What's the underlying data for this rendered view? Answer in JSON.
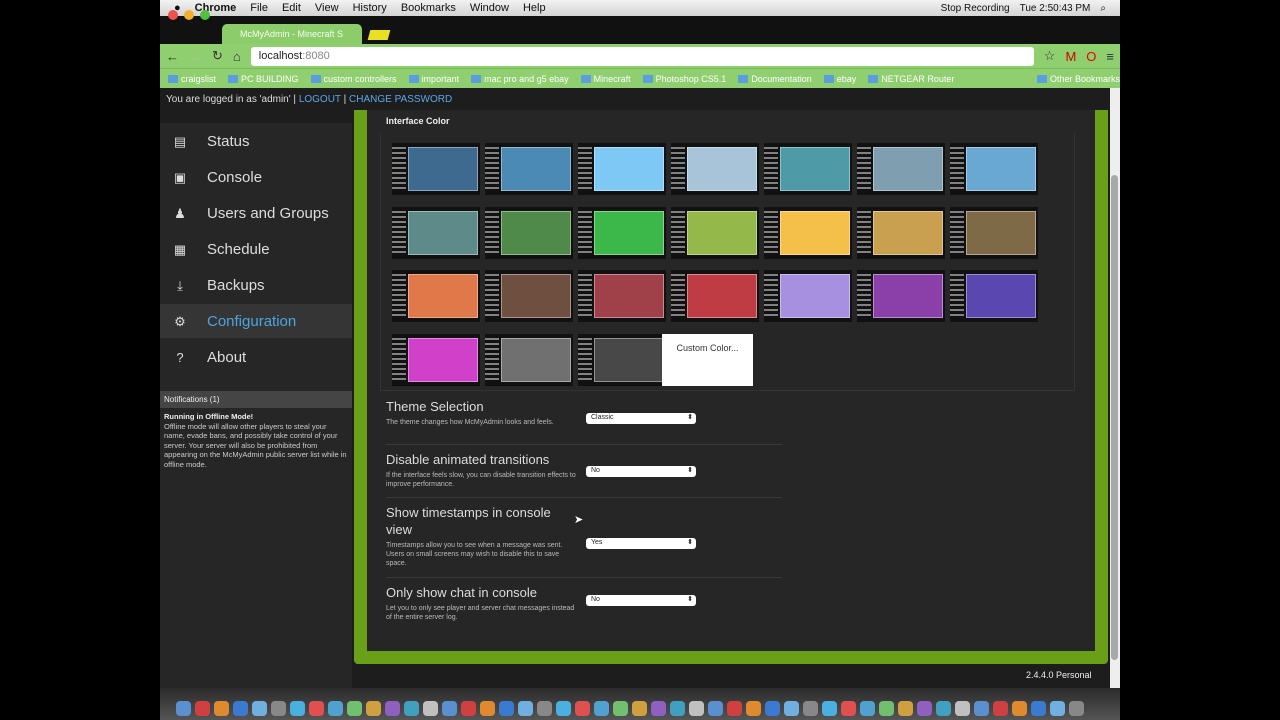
{
  "menubar": {
    "app": "Chrome",
    "items": [
      "File",
      "Edit",
      "View",
      "History",
      "Bookmarks",
      "Window",
      "Help"
    ],
    "status": [
      "Stop Recording",
      "Tue 2:50:43 PM"
    ]
  },
  "browser": {
    "tab_title": "McMyAdmin - Minecraft S",
    "url_host": "localhost",
    "url_port": ":8080",
    "bookmarks": [
      "craigslist",
      "PC BUILDING",
      "custom controllers",
      "important",
      "mac pro and g5 ebay",
      "Minecraft",
      "Photoshop CS5.1",
      "Documentation",
      "ebay",
      "NETGEAR Router",
      "Other Bookmarks"
    ]
  },
  "login": {
    "text": "You are logged in as 'admin' |",
    "logout": "LOGOUT",
    "sep": "|",
    "change_password": "CHANGE PASSWORD"
  },
  "sidebar": {
    "active": "Configuration",
    "items": [
      {
        "label": "Status",
        "icon": "status-icon",
        "glyph": "▤"
      },
      {
        "label": "Console",
        "icon": "console-icon",
        "glyph": "▣"
      },
      {
        "label": "Users and Groups",
        "icon": "users-icon",
        "glyph": "♟"
      },
      {
        "label": "Schedule",
        "icon": "calendar-icon",
        "glyph": "▦"
      },
      {
        "label": "Backups",
        "icon": "download-icon",
        "glyph": "⤓"
      },
      {
        "label": "Configuration",
        "icon": "gear-icon",
        "glyph": "⚙"
      },
      {
        "label": "About",
        "icon": "help-icon",
        "glyph": "?"
      }
    ]
  },
  "notifications": {
    "header": "Notifications (1)",
    "title": "Running in Offline Mode!",
    "body": "Offline mode will allow other players to steal your name, evade bans, and possibly take control of your server. Your server will also be prohibited from appearing on the McMyAdmin public server list while in offline mode."
  },
  "interface_color": {
    "title": "Interface Color",
    "custom_label": "Custom Color...",
    "colors": [
      [
        "#3f6a8f",
        "#4a8ab5",
        "#7ec8f5",
        "#a8c4d8",
        "#4e9aa6",
        "#7f9fb0",
        "#6aa8d4"
      ],
      [
        "#5f8a8a",
        "#4f8a4a",
        "#3cb84a",
        "#94b84a",
        "#f5c04a",
        "#c8a050",
        "#7f6a48"
      ],
      [
        "#e0784a",
        "#6f4f3f",
        "#a04048",
        "#c03c44",
        "#a890e0",
        "#8a40a8",
        "#5a48b0"
      ],
      [
        "#d040c8",
        "#707070",
        "#484848"
      ]
    ]
  },
  "settings": [
    {
      "title": "Theme Selection",
      "desc": "The theme changes how McMyAdmin looks and feels.",
      "value": "Classic"
    },
    {
      "title": "Disable animated transitions",
      "desc": "If the interface feels slow, you can disable transition effects to improve performance.",
      "value": "No"
    },
    {
      "title": "Show timestamps in console view",
      "desc": "Timestamps allow you to see when a message was sent. Users on small screens may wish to disable this to save space.",
      "value": "Yes"
    },
    {
      "title": "Only show chat in console",
      "desc": "Let you to only see player and server chat messages instead of the entire server log.",
      "value": "No"
    }
  ],
  "version": "2.4.4.0 Personal",
  "accent": "#6aa018"
}
